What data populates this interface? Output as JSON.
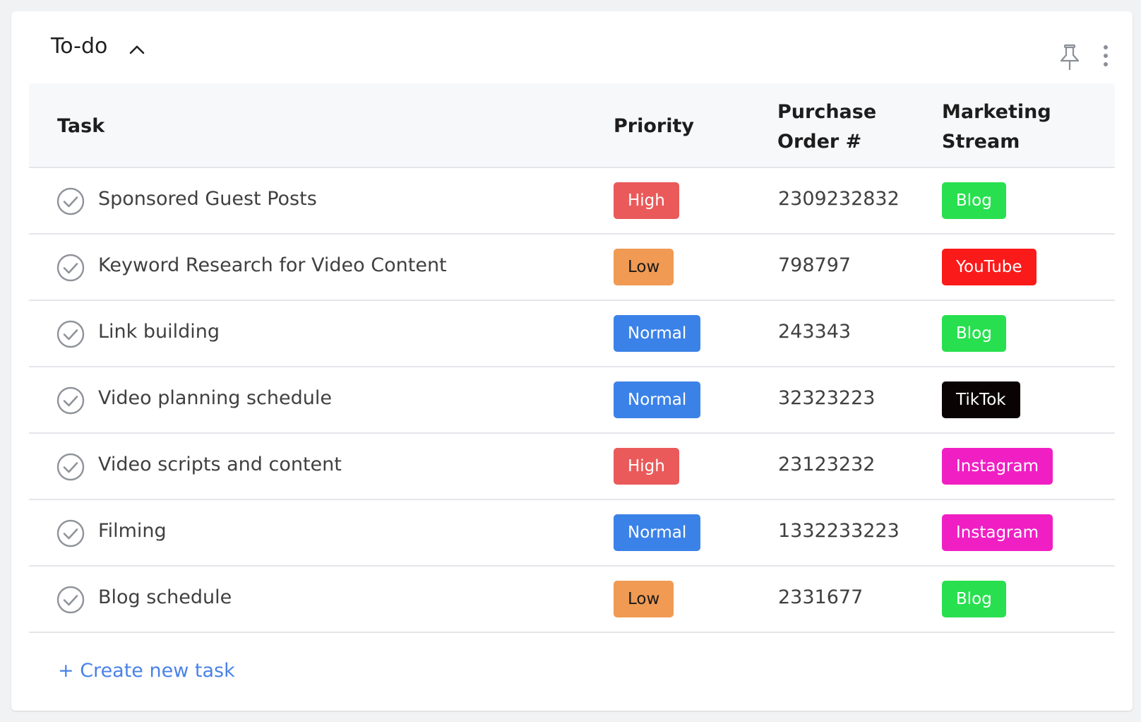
{
  "panel": {
    "title": "To-do"
  },
  "table": {
    "columns": {
      "task": "Task",
      "priority": "Priority",
      "purchase_order": "Purchase Order #",
      "marketing_stream": "Marketing Stream"
    },
    "rows": [
      {
        "task": "Sponsored Guest Posts",
        "priority": "High",
        "priority_color": "#ea5a5a",
        "po": "2309232832",
        "stream": "Blog",
        "stream_color": "#28e04f"
      },
      {
        "task": "Keyword Research for Video Content",
        "priority": "Low",
        "priority_color": "#f09a53",
        "po": "798797",
        "stream": "YouTube",
        "stream_color": "#fb1a1a"
      },
      {
        "task": "Link building",
        "priority": "Normal",
        "priority_color": "#3b82e8",
        "po": "243343",
        "stream": "Blog",
        "stream_color": "#28e04f"
      },
      {
        "task": "Video planning schedule",
        "priority": "Normal",
        "priority_color": "#3b82e8",
        "po": "32323223",
        "stream": "TikTok",
        "stream_color": "#0a0304"
      },
      {
        "task": "Video scripts and content",
        "priority": "High",
        "priority_color": "#ea5a5a",
        "po": "23123232",
        "stream": "Instagram",
        "stream_color": "#f01fc4"
      },
      {
        "task": "Filming",
        "priority": "Normal",
        "priority_color": "#3b82e8",
        "po": "1332233223",
        "stream": "Instagram",
        "stream_color": "#f01fc4"
      },
      {
        "task": "Blog schedule",
        "priority": "Low",
        "priority_color": "#f09a53",
        "po": "2331677",
        "stream": "Blog",
        "stream_color": "#28e04f"
      }
    ]
  },
  "footer": {
    "create_label": "+ Create new task"
  },
  "icons": {
    "collapse": "chevron-up-icon",
    "pin": "pin-icon",
    "more": "more-vertical-icon",
    "complete": "check-circle-icon"
  }
}
